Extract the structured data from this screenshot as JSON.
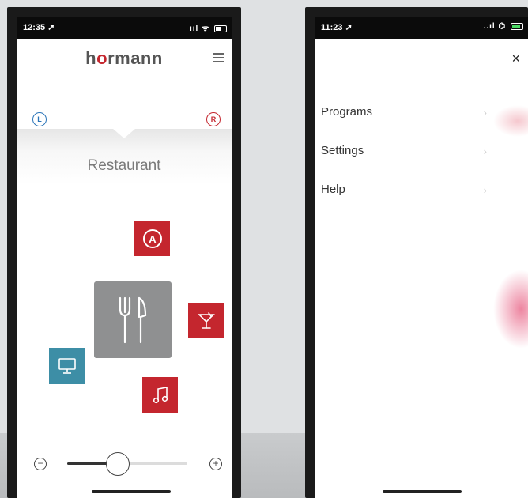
{
  "left_phone": {
    "status": {
      "time": "12:35 ➚",
      "icons": "ııl ᯤ"
    },
    "brand": {
      "pre": "h",
      "o": "o",
      "post": "rmann"
    },
    "buttons": {
      "left_badge": "L",
      "right_badge": "R"
    },
    "program": {
      "title": "Restaurant"
    },
    "tiles": {
      "a_label": "A"
    },
    "slider": {
      "minus": "−",
      "plus": "+",
      "value": 0.42
    }
  },
  "right_phone": {
    "status": {
      "time": "11:23 ➚",
      "icons": "..ıl ⌬"
    },
    "close_label": "×",
    "menu": [
      {
        "label": "Programs"
      },
      {
        "label": "Settings"
      },
      {
        "label": "Help"
      }
    ],
    "chevron": "›"
  },
  "colors": {
    "brand_red": "#c4262e",
    "teal": "#3d8ea6",
    "tile_gray": "#8f9091",
    "blue_badge": "#2a74b8"
  }
}
